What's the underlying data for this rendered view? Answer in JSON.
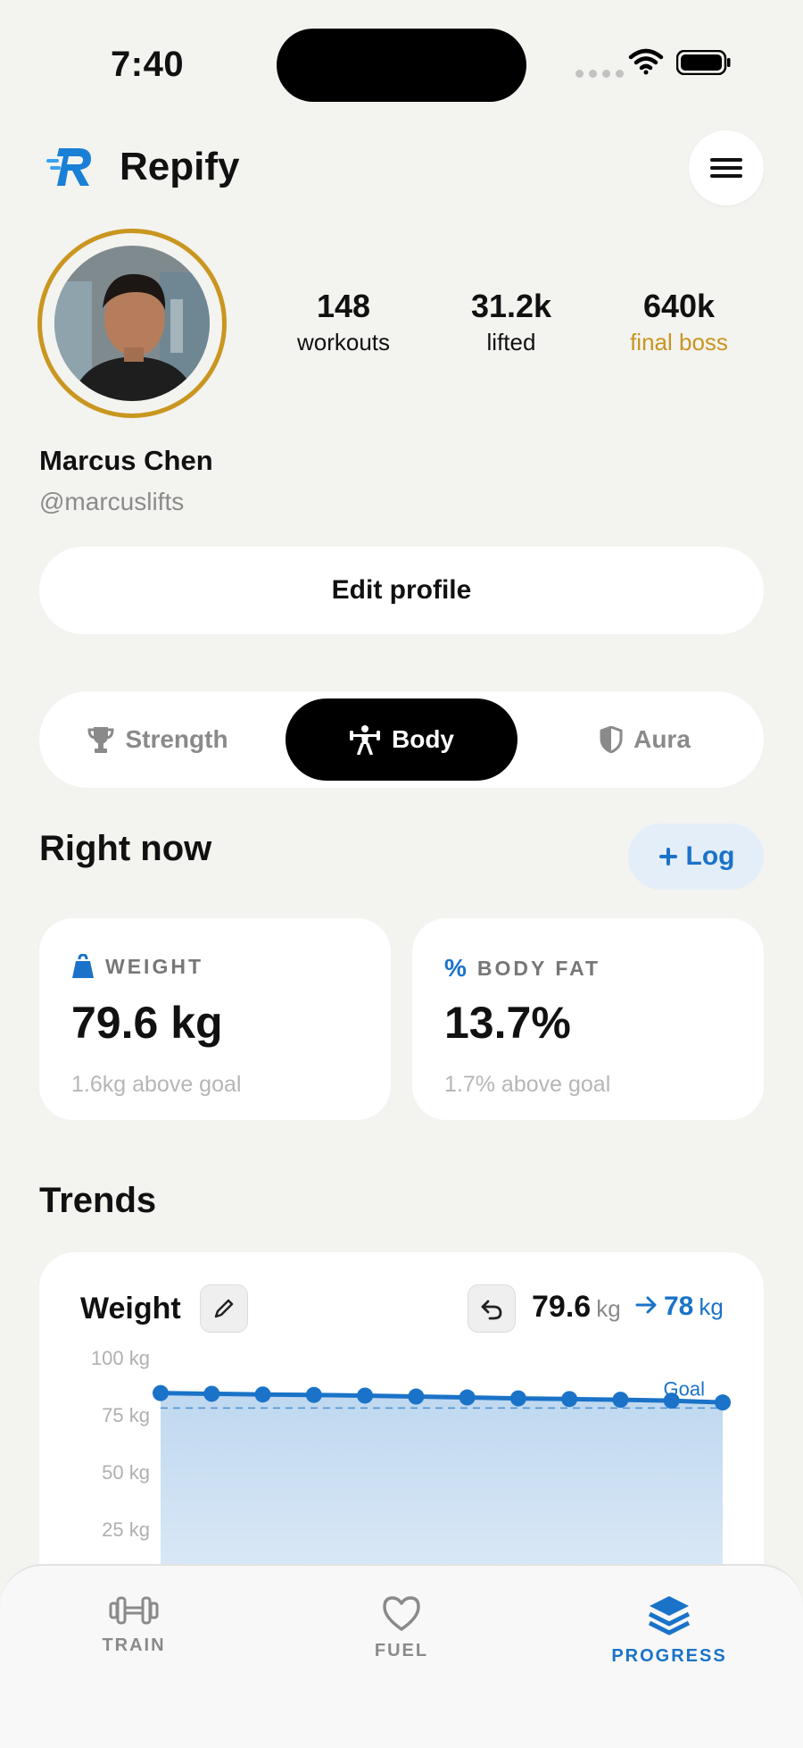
{
  "status": {
    "time": "7:40"
  },
  "header": {
    "app_name": "Repify",
    "logo_icon": "repify-logo",
    "menu_icon": "hamburger-menu-icon"
  },
  "profile": {
    "name": "Marcus Chen",
    "handle": "@marcuslifts",
    "stats": [
      {
        "value": "148",
        "label": "workouts"
      },
      {
        "value": "31.2k",
        "label": "lifted"
      },
      {
        "value": "640k",
        "label": "final boss"
      }
    ],
    "edit_label": "Edit profile"
  },
  "tabs": [
    {
      "label": "Strength",
      "icon": "trophy-icon",
      "active": false
    },
    {
      "label": "Body",
      "icon": "body-icon",
      "active": true
    },
    {
      "label": "Aura",
      "icon": "shield-icon",
      "active": false
    }
  ],
  "right_now": {
    "title": "Right now",
    "log_label": "Log",
    "weight": {
      "heading": "WEIGHT",
      "value": "79.6 kg",
      "sub": "1.6kg above goal"
    },
    "body_fat": {
      "heading": "BODY FAT",
      "icon_text": "%",
      "value": "13.7%",
      "sub": "1.7% above goal"
    }
  },
  "trends": {
    "title": "Trends",
    "card_title": "Weight",
    "current": "79.6",
    "current_unit": "kg",
    "target": "78",
    "target_unit": "kg",
    "goal_label": "Goal"
  },
  "chart_data": {
    "type": "area",
    "series": [
      {
        "values": [
          84.5,
          84.2,
          83.9,
          83.7,
          83.4,
          83.0,
          82.6,
          82.2,
          81.9,
          81.6,
          81.2,
          80.4
        ]
      }
    ],
    "ylim": [
      25,
      100
    ],
    "yticks": [
      "100 kg",
      "75 kg",
      "50 kg",
      "25 kg"
    ],
    "goal": 78,
    "color": "#1a73c8"
  },
  "nav": [
    {
      "label": "TRAIN",
      "icon": "dumbbell-icon",
      "active": false
    },
    {
      "label": "FUEL",
      "icon": "heart-icon",
      "active": false
    },
    {
      "label": "PROGRESS",
      "icon": "layers-icon",
      "active": true
    }
  ]
}
